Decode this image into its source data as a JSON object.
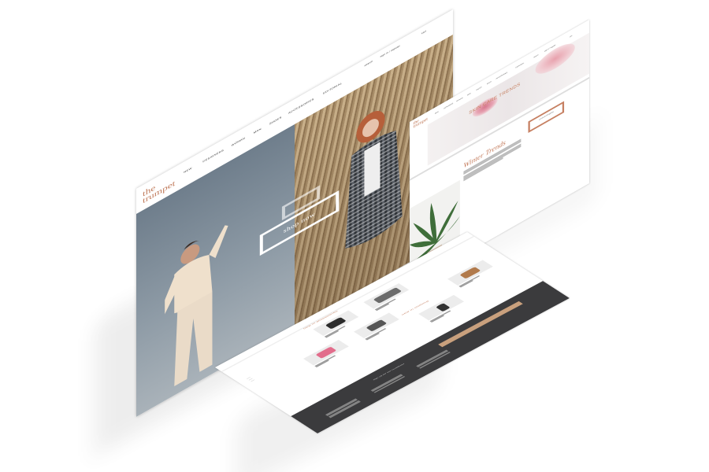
{
  "main_screen": {
    "logo": [
      "the",
      "trumpet"
    ],
    "nav": [
      "NEW",
      "DESIGNERS",
      "WOMAN",
      "MAN",
      "SHOES",
      "ACCESSORIES",
      "EDITORIAL"
    ],
    "utility": [
      "search",
      "sign in / register",
      "cart"
    ],
    "cta": "shop now"
  },
  "skin_screen": {
    "logo": [
      "the",
      "trumpet"
    ],
    "nav": [
      "NEW",
      "DESIGNERS",
      "WOMAN",
      "MAN",
      "SHOES",
      "BAGS",
      "ACCESSORIES",
      "EDITORIAL"
    ],
    "utility": [
      "search",
      "sign in / register",
      "cart"
    ],
    "banner_title": "SKIN CARE TRENDS",
    "heading": "Winter Trends",
    "button": "continue shopping"
  },
  "shop_screen": {
    "section_title": "new in accessories",
    "section_title_2": "new in clothing",
    "subscribe_label": "sign up for our newsletter",
    "colors": {
      "accent": "#c68062",
      "footer": "#3b3b3d"
    }
  }
}
